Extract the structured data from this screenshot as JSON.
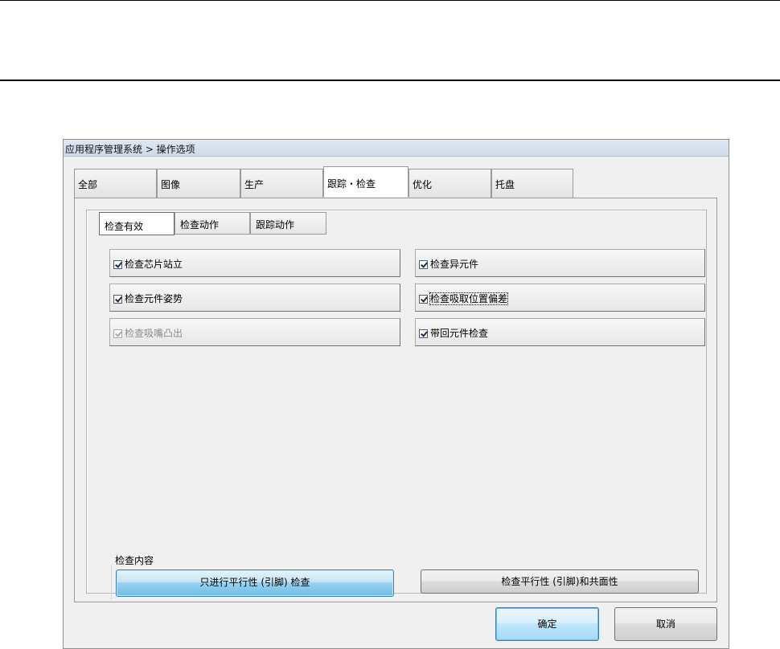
{
  "window": {
    "title": "应用程序管理系统 > 操作选项"
  },
  "main_tabs": [
    {
      "label": "全部"
    },
    {
      "label": "图像"
    },
    {
      "label": "生产"
    },
    {
      "label": "跟踪・检查",
      "active": true
    },
    {
      "label": "优化"
    },
    {
      "label": "托盘"
    }
  ],
  "sub_tabs": [
    {
      "label": "检查有效",
      "active": true
    },
    {
      "label": "检查动作"
    },
    {
      "label": "跟踪动作"
    }
  ],
  "options": [
    {
      "label": "检查芯片站立",
      "checked": true,
      "enabled": true
    },
    {
      "label": "检查异元件",
      "checked": true,
      "enabled": true
    },
    {
      "label": "检查元件姿势",
      "checked": true,
      "enabled": true
    },
    {
      "label": "检查吸取位置偏差",
      "checked": true,
      "enabled": true
    },
    {
      "label": "检查吸嘴凸出",
      "checked": true,
      "enabled": false
    },
    {
      "label": "带回元件检查",
      "checked": true,
      "enabled": true
    }
  ],
  "inspection_content": {
    "label": "检查内容",
    "option_parallel_only": "只进行平行性 (引脚) 检查",
    "option_parallel_coplanarity": "检查平行性 (引脚)和共面性"
  },
  "footer": {
    "ok_label": "确定",
    "cancel_label": "取消"
  }
}
